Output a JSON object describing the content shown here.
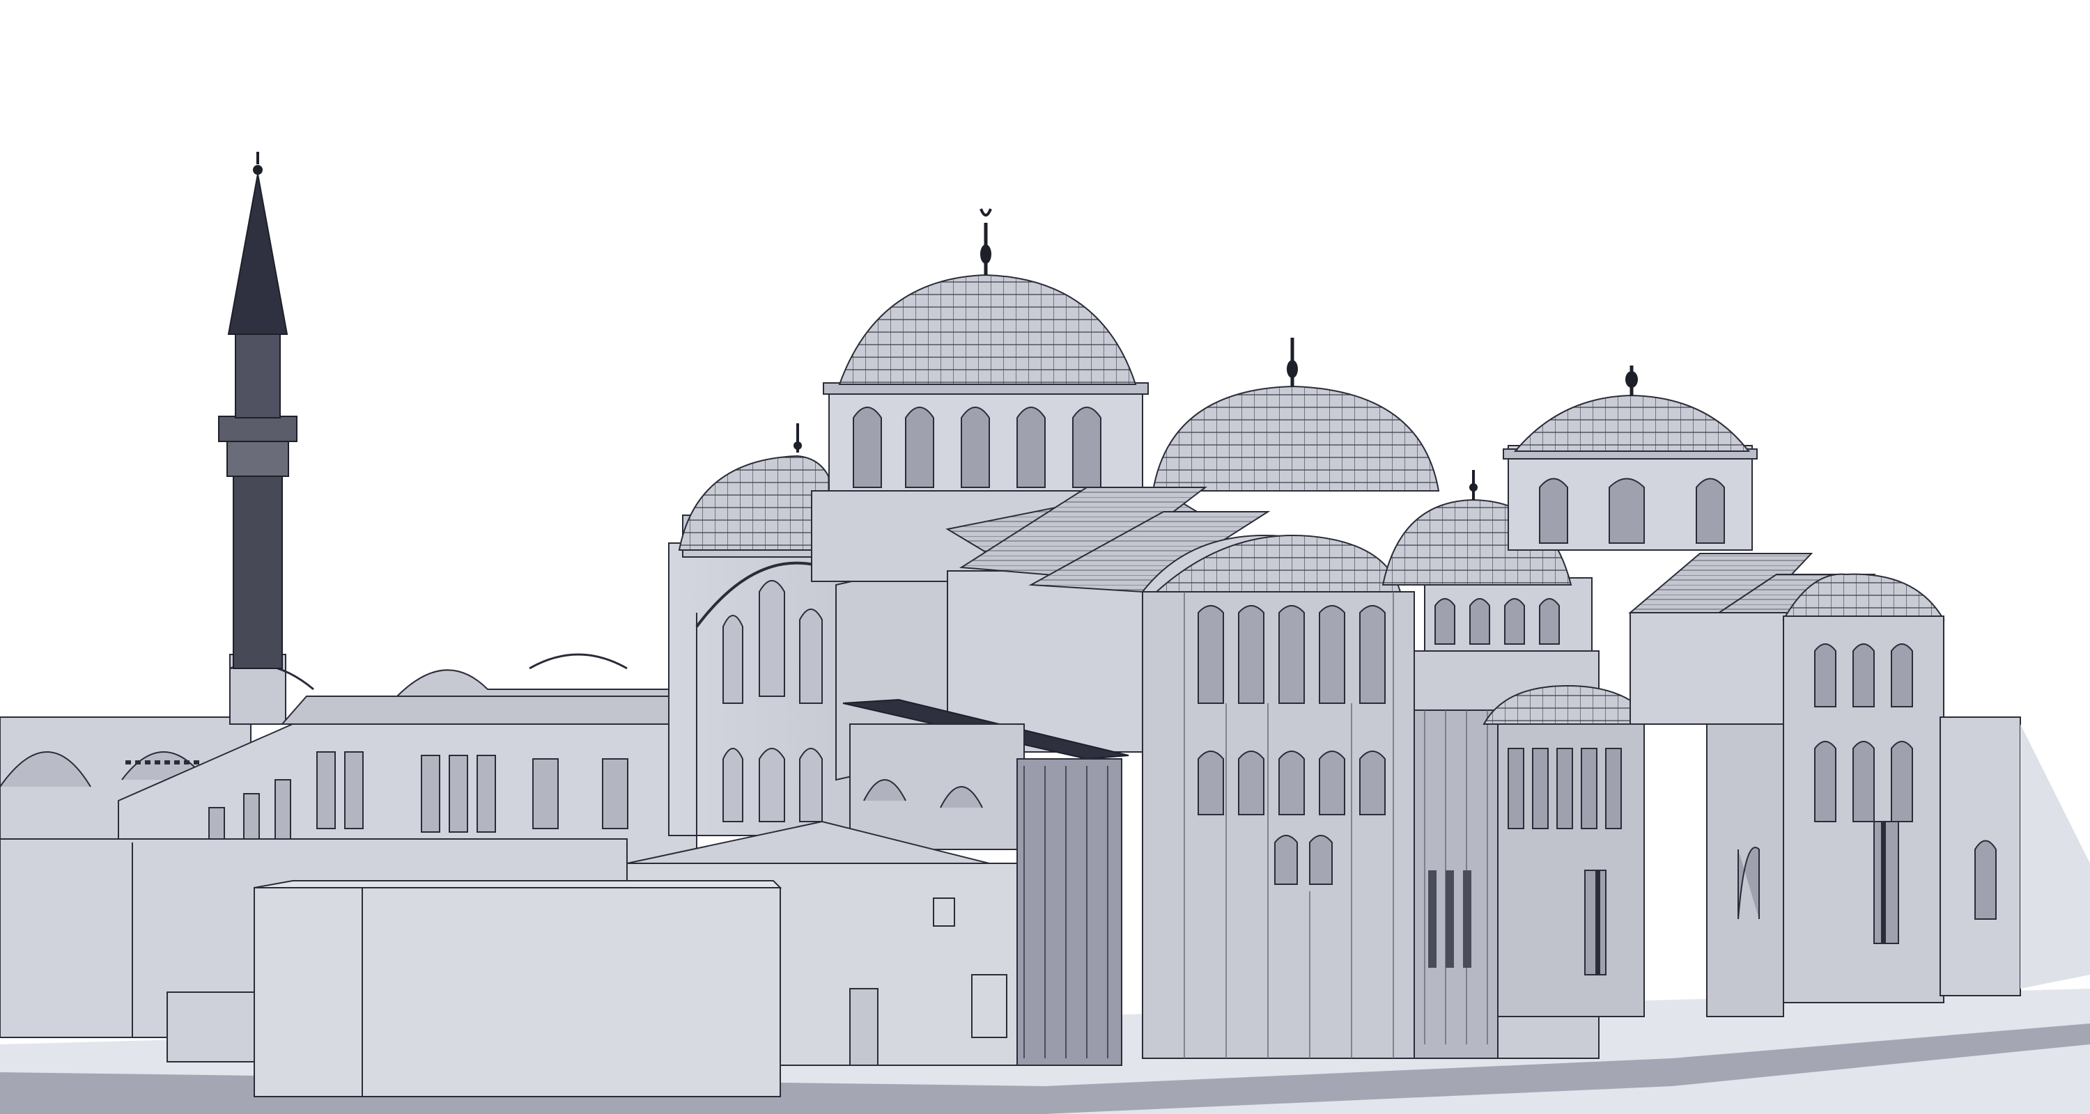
{
  "image": {
    "subject": "",
    "colors": {
      "sky": "#ffffff",
      "wall_light": "#d9dbe3",
      "wall_mid": "#c5c7d1",
      "wall_dark": "#a9abb8",
      "roof": "#b8bac6",
      "line": "#2a2c38",
      "ground": "#e3e5ec",
      "ground_shadow": "#9a9cab"
    }
  }
}
